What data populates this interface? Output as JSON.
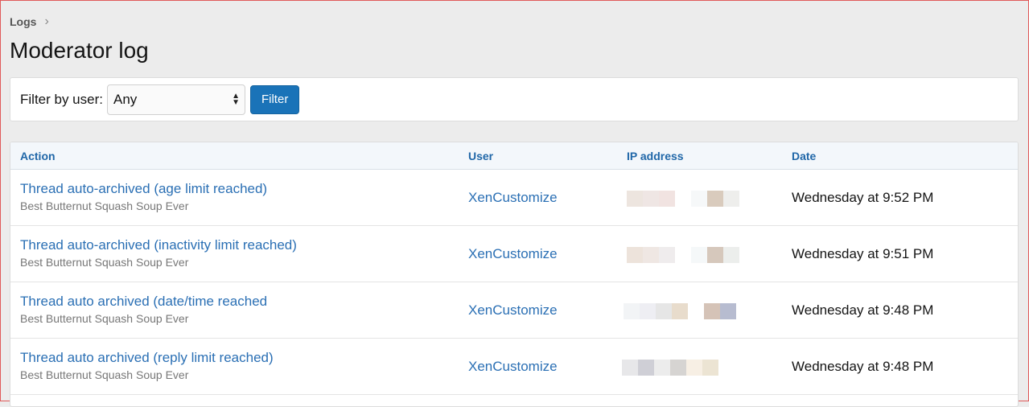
{
  "breadcrumb": {
    "item": "Logs"
  },
  "page_title": "Moderator log",
  "filter": {
    "label": "Filter by user:",
    "selected": "Any",
    "button_label": "Filter"
  },
  "table": {
    "headers": {
      "action": "Action",
      "user": "User",
      "ip": "IP address",
      "date": "Date"
    },
    "rows": [
      {
        "action": "Thread auto-archived (age limit reached)",
        "thread": "Best Butternut Squash Soup Ever",
        "user": "XenCustomize",
        "date": "Wednesday at 9:52 PM",
        "ip_colors": [
          "#ede5df",
          "#efe6e4",
          "#f1e3e1",
          "#ffffff",
          "#f6f8f9",
          "#d9cbbd",
          "#eeeeec"
        ]
      },
      {
        "action": "Thread auto-archived (inactivity limit reached)",
        "thread": "Best Butternut Squash Soup Ever",
        "user": "XenCustomize",
        "date": "Wednesday at 9:51 PM",
        "ip_colors": [
          "#ede3db",
          "#efe7e3",
          "#efeced",
          "#ffffff",
          "#f5f8f9",
          "#d6c8bc",
          "#eceeec"
        ]
      },
      {
        "action": "Thread auto archived (date/time reached",
        "thread": "Best Butternut Squash Soup Ever",
        "user": "XenCustomize",
        "date": "Wednesday at 9:48 PM",
        "ip_colors": [
          "#f2f4f6",
          "#eeeef3",
          "#e6e6e6",
          "#e8dccc",
          "#ffffff",
          "#d5c3b7",
          "#b7bcd0"
        ]
      },
      {
        "action": "Thread auto archived (reply limit reached)",
        "thread": "Best Butternut Squash Soup Ever",
        "user": "XenCustomize",
        "date": "Wednesday at 9:48 PM",
        "ip_colors": [
          "#e7e7e9",
          "#cfcfd6",
          "#ececec",
          "#d6d4d2",
          "#f7efe4",
          "#ece4d3"
        ]
      }
    ]
  }
}
